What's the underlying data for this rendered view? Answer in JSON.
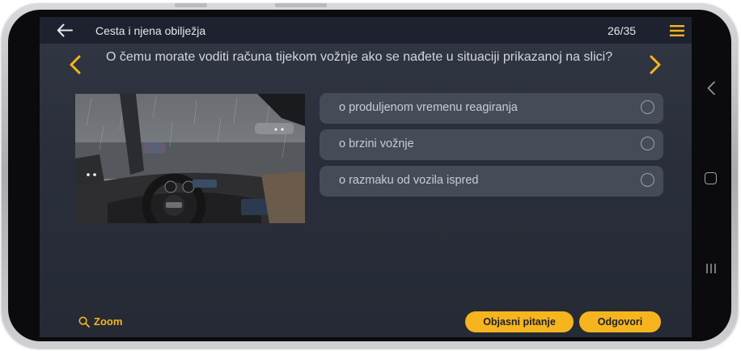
{
  "header": {
    "title": "Cesta i njena obilježja",
    "counter": "26/35"
  },
  "question": {
    "text": "O čemu morate voditi računa tijekom vožnje ako se nađete u situaciji prikazanoj na slici?"
  },
  "answers": [
    {
      "label": "o produljenom vremenu reagiranja",
      "selected": false
    },
    {
      "label": "o brzini vožnje",
      "selected": false
    },
    {
      "label": "o razmaku od vozila ispred",
      "selected": false
    }
  ],
  "footer": {
    "zoom_label": "Zoom",
    "explain_label": "Objasni pitanje",
    "answer_label": "Odgovori"
  },
  "icons": {
    "back": "arrow-left-icon",
    "menu": "hamburger-menu-icon",
    "prev": "chevron-left-icon",
    "next": "chevron-right-icon",
    "zoom": "magnifier-icon",
    "system_back": "android-back-icon",
    "system_home": "android-home-icon",
    "system_recent": "android-recent-icon"
  },
  "colors": {
    "accent": "#f6b51e",
    "background": "#2a2f3b",
    "topbar": "#1e2230",
    "answer_bg": "#464b58"
  }
}
